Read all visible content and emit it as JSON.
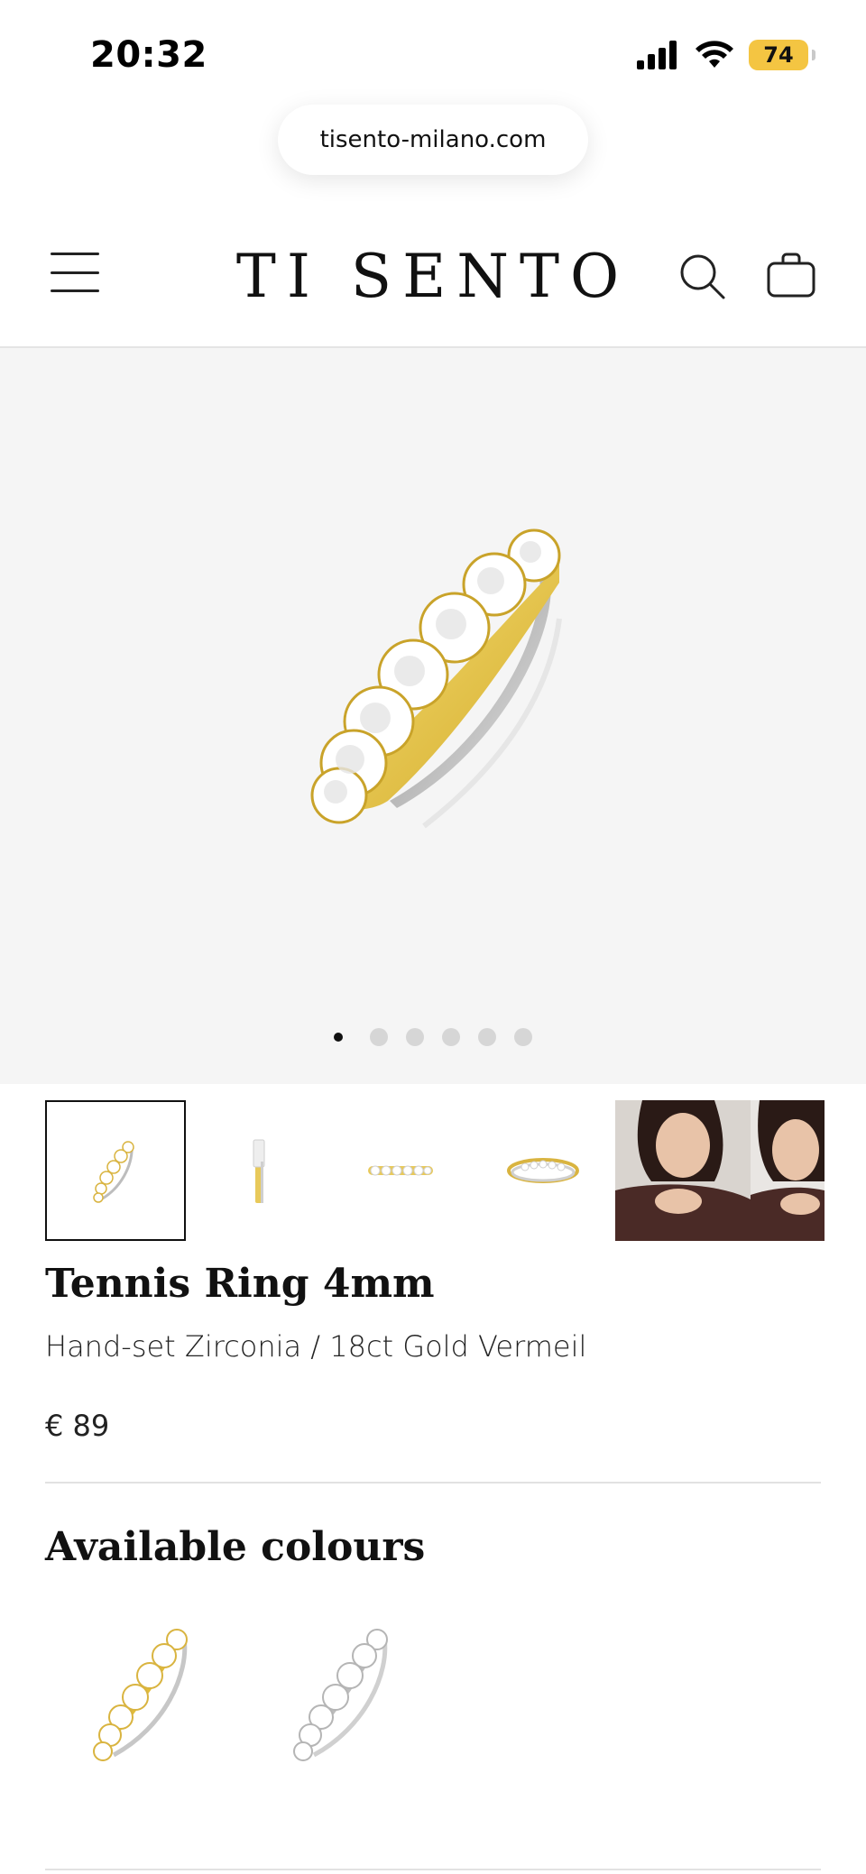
{
  "status_bar": {
    "time": "20:32",
    "battery": "74"
  },
  "browser": {
    "url": "tisento-milano.com"
  },
  "header": {
    "logo": "TI SENTO",
    "menu_icon": "hamburger-menu-icon",
    "search_icon": "search-icon",
    "bag_icon": "shopping-bag-icon"
  },
  "gallery": {
    "slide_count": 6,
    "active_slide": 1,
    "thumbnails": [
      {
        "kind": "ring-angled",
        "selected": true
      },
      {
        "kind": "ring-side",
        "selected": false
      },
      {
        "kind": "ring-top",
        "selected": false
      },
      {
        "kind": "ring-front",
        "selected": false
      },
      {
        "kind": "model-photo",
        "selected": false
      }
    ]
  },
  "product": {
    "title": "Tennis Ring 4mm",
    "subtitle": "Hand-set Zirconia / 18ct Gold Vermeil",
    "price": "€ 89"
  },
  "colours": {
    "heading": "Available colours",
    "options": [
      {
        "name": "gold",
        "color": "#e6c34a"
      },
      {
        "name": "silver",
        "color": "#cfcfcf"
      }
    ]
  },
  "colors": {
    "accent_gold": "#e0bc3c",
    "battery": "#f4c542",
    "hero_bg": "#f5f5f5"
  }
}
